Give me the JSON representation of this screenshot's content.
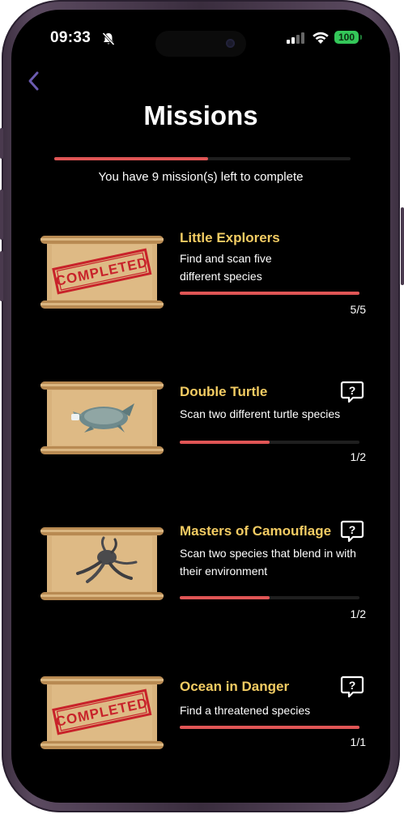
{
  "status_bar": {
    "time": "09:33",
    "battery": "100"
  },
  "header": {
    "title": "Missions"
  },
  "summary": {
    "progress": 0.52,
    "text": "You have  9 mission(s) left to complete"
  },
  "missions": [
    {
      "title": "Little Explorers",
      "desc": "Find and scan five different species",
      "count": "5/5",
      "progress": 1.0,
      "image": "completed-stamp"
    },
    {
      "title": "Double Turtle",
      "desc": "Scan two different turtle species",
      "count": "1/2",
      "progress": 0.5,
      "image": "turtle"
    },
    {
      "title": "Masters of Camouflage",
      "desc": "Scan two species that blend in with their environment",
      "count": "1/2",
      "progress": 0.5,
      "image": "octopus"
    },
    {
      "title": "Ocean in Danger",
      "desc": "Find a threatened species",
      "count": "1/1",
      "progress": 1.0,
      "image": "completed-stamp"
    }
  ],
  "stamp_text": "COMPLETED",
  "colors": {
    "accent": "#e05555",
    "title": "#f3cc63",
    "background": "#000000"
  }
}
